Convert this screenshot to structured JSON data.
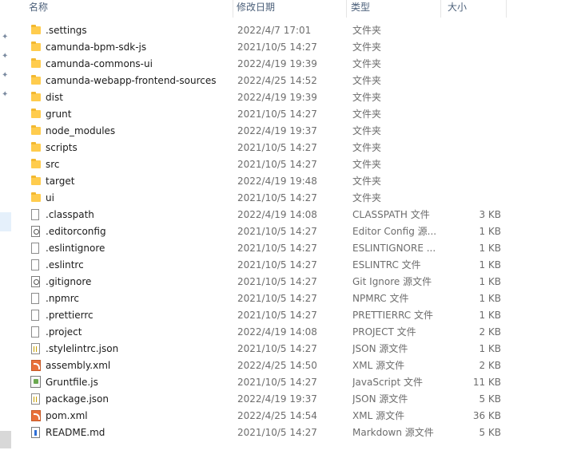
{
  "header": {
    "name": "名称",
    "date": "修改日期",
    "type": "类型",
    "size": "大小"
  },
  "files": [
    {
      "name": ".settings",
      "date": "2022/4/7 17:01",
      "type": "文件夹",
      "size": "",
      "icon": "folder-icon"
    },
    {
      "name": "camunda-bpm-sdk-js",
      "date": "2021/10/5 14:27",
      "type": "文件夹",
      "size": "",
      "icon": "folder-icon"
    },
    {
      "name": "camunda-commons-ui",
      "date": "2022/4/19 19:39",
      "type": "文件夹",
      "size": "",
      "icon": "folder-icon"
    },
    {
      "name": "camunda-webapp-frontend-sources",
      "date": "2022/4/25 14:52",
      "type": "文件夹",
      "size": "",
      "icon": "folder-icon"
    },
    {
      "name": "dist",
      "date": "2022/4/19 19:39",
      "type": "文件夹",
      "size": "",
      "icon": "folder-icon"
    },
    {
      "name": "grunt",
      "date": "2021/10/5 14:27",
      "type": "文件夹",
      "size": "",
      "icon": "folder-icon"
    },
    {
      "name": "node_modules",
      "date": "2022/4/19 19:37",
      "type": "文件夹",
      "size": "",
      "icon": "folder-icon"
    },
    {
      "name": "scripts",
      "date": "2021/10/5 14:27",
      "type": "文件夹",
      "size": "",
      "icon": "folder-icon"
    },
    {
      "name": "src",
      "date": "2021/10/5 14:27",
      "type": "文件夹",
      "size": "",
      "icon": "folder-icon"
    },
    {
      "name": "target",
      "date": "2022/4/19 19:48",
      "type": "文件夹",
      "size": "",
      "icon": "folder-icon"
    },
    {
      "name": "ui",
      "date": "2021/10/5 14:27",
      "type": "文件夹",
      "size": "",
      "icon": "folder-icon"
    },
    {
      "name": ".classpath",
      "date": "2022/4/19 14:08",
      "type": "CLASSPATH 文件",
      "size": "3 KB",
      "icon": "file-icon"
    },
    {
      "name": ".editorconfig",
      "date": "2021/10/5 14:27",
      "type": "Editor Config 源...",
      "size": "1 KB",
      "icon": "config-file-icon"
    },
    {
      "name": ".eslintignore",
      "date": "2021/10/5 14:27",
      "type": "ESLINTIGNORE ...",
      "size": "1 KB",
      "icon": "file-icon"
    },
    {
      "name": ".eslintrc",
      "date": "2021/10/5 14:27",
      "type": "ESLINTRC 文件",
      "size": "1 KB",
      "icon": "file-icon"
    },
    {
      "name": ".gitignore",
      "date": "2021/10/5 14:27",
      "type": "Git Ignore 源文件",
      "size": "1 KB",
      "icon": "config-file-icon"
    },
    {
      "name": ".npmrc",
      "date": "2021/10/5 14:27",
      "type": "NPMRC 文件",
      "size": "1 KB",
      "icon": "file-icon"
    },
    {
      "name": ".prettierrc",
      "date": "2021/10/5 14:27",
      "type": "PRETTIERRC 文件",
      "size": "1 KB",
      "icon": "file-icon"
    },
    {
      "name": ".project",
      "date": "2022/4/19 14:08",
      "type": "PROJECT 文件",
      "size": "2 KB",
      "icon": "file-icon"
    },
    {
      "name": ".stylelintrc.json",
      "date": "2021/10/5 14:27",
      "type": "JSON 源文件",
      "size": "1 KB",
      "icon": "json-file-icon"
    },
    {
      "name": "assembly.xml",
      "date": "2022/4/25 14:50",
      "type": "XML 源文件",
      "size": "2 KB",
      "icon": "xml-file-icon"
    },
    {
      "name": "Gruntfile.js",
      "date": "2021/10/5 14:27",
      "type": "JavaScript 文件",
      "size": "11 KB",
      "icon": "javascript-file-icon"
    },
    {
      "name": "package.json",
      "date": "2022/4/19 19:37",
      "type": "JSON 源文件",
      "size": "5 KB",
      "icon": "json-file-icon"
    },
    {
      "name": "pom.xml",
      "date": "2022/4/25 14:54",
      "type": "XML 源文件",
      "size": "36 KB",
      "icon": "xml-file-icon"
    },
    {
      "name": "README.md",
      "date": "2021/10/5 14:27",
      "type": "Markdown 源文件",
      "size": "5 KB",
      "icon": "markdown-file-icon"
    }
  ]
}
